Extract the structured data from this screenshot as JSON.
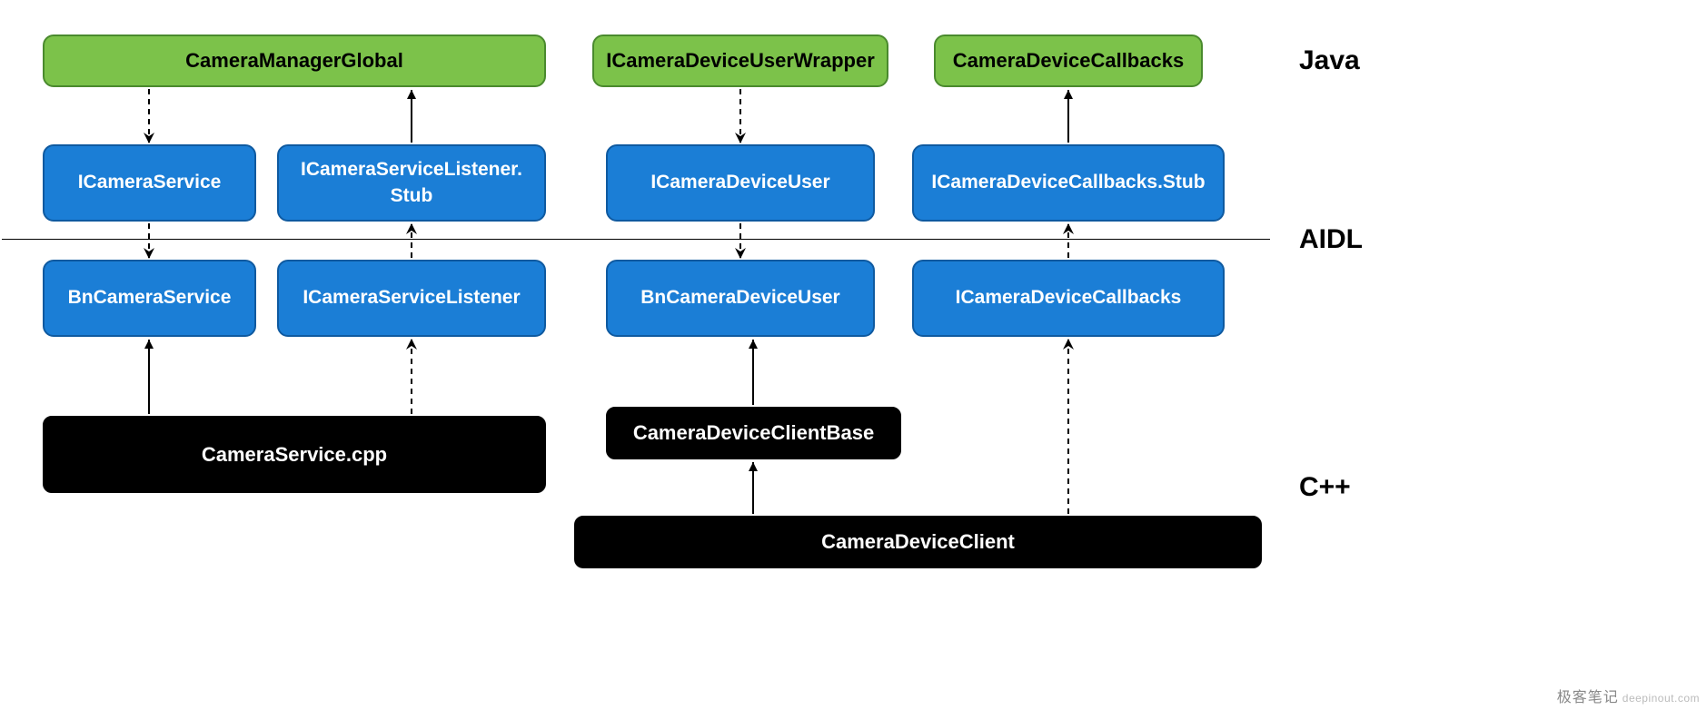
{
  "layers": {
    "java": "Java",
    "aidl": "AIDL",
    "cpp": "C++"
  },
  "boxes": {
    "cameraManagerGlobal": "CameraManagerGlobal",
    "iCameraDeviceUserWrapper": "ICameraDeviceUserWrapper",
    "cameraDeviceCallbacks": "CameraDeviceCallbacks",
    "iCameraService": "ICameraService",
    "iCameraServiceListenerStub": "ICameraServiceListener.\nStub",
    "iCameraDeviceUser": "ICameraDeviceUser",
    "iCameraDeviceCallbacksStub": "ICameraDeviceCallbacks.Stub",
    "bnCameraService": "BnCameraService",
    "iCameraServiceListener": "ICameraServiceListener",
    "bnCameraDeviceUser": "BnCameraDeviceUser",
    "iCameraDeviceCallbacks": "ICameraDeviceCallbacks",
    "cameraServiceCpp": "CameraService.cpp",
    "cameraDeviceClientBase": "CameraDeviceClientBase",
    "cameraDeviceClient": "CameraDeviceClient"
  },
  "watermark": {
    "zh": "极客笔记",
    "en": "deepinout.com"
  }
}
